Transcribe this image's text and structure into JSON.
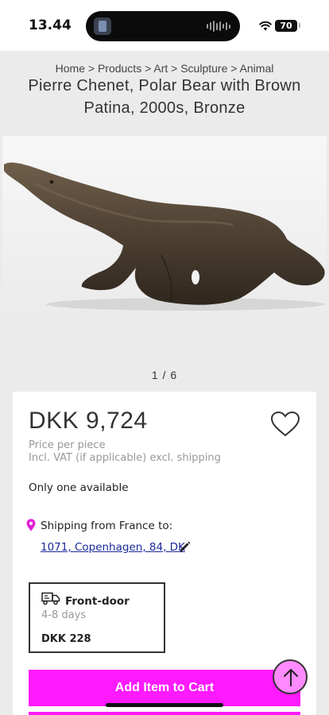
{
  "status_bar": {
    "time": "13.44",
    "battery": "70"
  },
  "breadcrumb": "Home > Products > Art > Sculpture > Animal",
  "product": {
    "title": "Pierre Chenet, Polar Bear with Brown Patina, 2000s, Bronze",
    "image_counter": "1 / 6",
    "price": "DKK 9,724",
    "price_per": "Price per piece",
    "vat_note": "Incl. VAT (if applicable) excl. shipping",
    "availability": "Only one available"
  },
  "shipping": {
    "from": "Shipping from France to:",
    "address": "1071, Copenhagen, 84, DK",
    "option": {
      "title": "Front-door",
      "days": "4-8 days",
      "price": "DKK 228"
    }
  },
  "actions": {
    "add_to_cart": "Add Item to Cart"
  },
  "colors": {
    "accent": "#ff1aff",
    "link": "#1a2a9a",
    "pin": "#e020d8"
  },
  "icons": {
    "heart": "heart-icon",
    "pin": "location-pin-icon",
    "pencil": "pencil-icon",
    "truck": "truck-icon",
    "scroll_top": "arrow-up-icon"
  }
}
